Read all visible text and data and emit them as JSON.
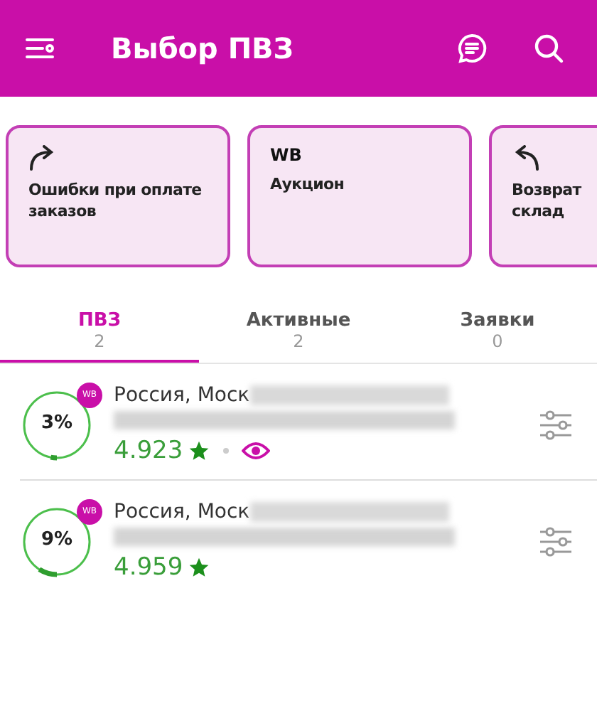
{
  "header": {
    "title": "Выбор ПВЗ"
  },
  "cards": [
    {
      "kind": "arrow-right",
      "label": "Ошибки при оплате заказов"
    },
    {
      "kind": "brand",
      "brand": "WB",
      "label": "Аукцион"
    },
    {
      "kind": "arrow-left",
      "label": "Возврат\nсклад"
    }
  ],
  "tabs": [
    {
      "label": "ПВЗ",
      "count": "2",
      "selected": true
    },
    {
      "label": "Активные",
      "count": "2",
      "selected": false
    },
    {
      "label": "Заявки",
      "count": "0",
      "selected": false
    }
  ],
  "points": [
    {
      "percent": "3%",
      "level": 0.03,
      "badge": "WB",
      "address": "Россия, Моск",
      "rating": "4.923",
      "viewed": true
    },
    {
      "percent": "9%",
      "level": 0.09,
      "badge": "WB",
      "address": "Россия, Моск",
      "rating": "4.959",
      "viewed": false
    }
  ]
}
